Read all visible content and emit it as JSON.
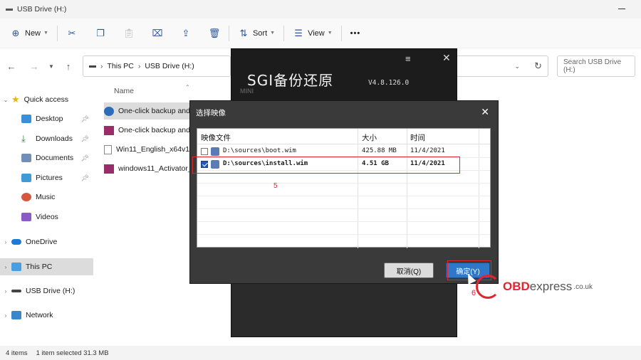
{
  "window": {
    "title": "USB Drive (H:)"
  },
  "toolbar": {
    "new": "New",
    "sort": "Sort",
    "view": "View",
    "more": "•••"
  },
  "address": {
    "this_pc": "This PC",
    "drive": "USB Drive (H:)",
    "search_placeholder": "Search USB Drive (H:)"
  },
  "sidebar": {
    "quick_access": "Quick access",
    "items": [
      "Desktop",
      "Downloads",
      "Documents",
      "Pictures",
      "Music",
      "Videos"
    ],
    "onedrive": "OneDrive",
    "this_pc": "This PC",
    "usb": "USB Drive (H:)",
    "network": "Network"
  },
  "files": {
    "col_name": "Name",
    "rows": [
      "One-click backup and",
      "One-click backup and",
      "Win11_English_x64v1",
      "windows11_Activator_"
    ]
  },
  "status": {
    "count": "4 items",
    "selected": "1 item selected  31.3 MB"
  },
  "sgi": {
    "title": "SGI备份还原",
    "version": "V4.8.126.0",
    "mini": "MINI"
  },
  "dialog": {
    "title": "选择映像",
    "col_file": "映像文件",
    "col_size": "大小",
    "col_time": "时间",
    "rows": [
      {
        "path": "D:\\sources\\boot.wim",
        "size": "425.88 MB",
        "time": "11/4/2021",
        "checked": false
      },
      {
        "path": "D:\\sources\\install.wim",
        "size": "4.51 GB",
        "time": "11/4/2021",
        "checked": true
      }
    ],
    "cancel": "取消(Q)",
    "ok": "确定(Y)"
  },
  "annotations": {
    "step5": "5",
    "step6": "6"
  },
  "watermark": {
    "brand": "OBD",
    "brand2": "express",
    "tld": ".co.uk"
  },
  "colors": {
    "accent_red": "#e0262e",
    "ok_blue": "#2f77c9"
  }
}
